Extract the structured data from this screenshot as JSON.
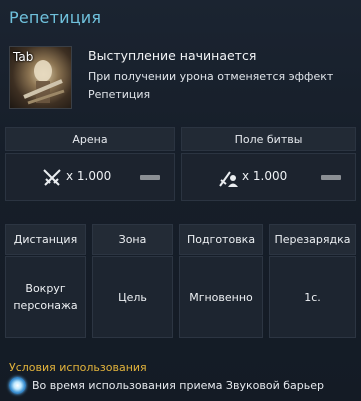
{
  "skill": {
    "title": "Репетиция",
    "keybind": "Tab",
    "name": "Выступление начинается",
    "description": "При получении урона отменяется эффект Репетиция"
  },
  "modes": [
    {
      "label": "Арена",
      "value": "x 1.000",
      "icon": "crossed-swords-icon"
    },
    {
      "label": "Поле битвы",
      "value": "x 1.000",
      "icon": "sword-person-icon"
    }
  ],
  "attributes": {
    "headers": [
      "Дистанция",
      "Зона",
      "Подготовка",
      "Перезарядка"
    ],
    "values": [
      "Вокруг персонажа",
      "Цель",
      "Мгновенно",
      "1с."
    ]
  },
  "conditions": {
    "title": "Условия использования",
    "text": "Во время использования приема Звуковой барьер",
    "icon": "sound-barrier-icon"
  },
  "colors": {
    "title": "#6fc1dc",
    "condition_title": "#e3b43c",
    "background": "#161e29"
  }
}
